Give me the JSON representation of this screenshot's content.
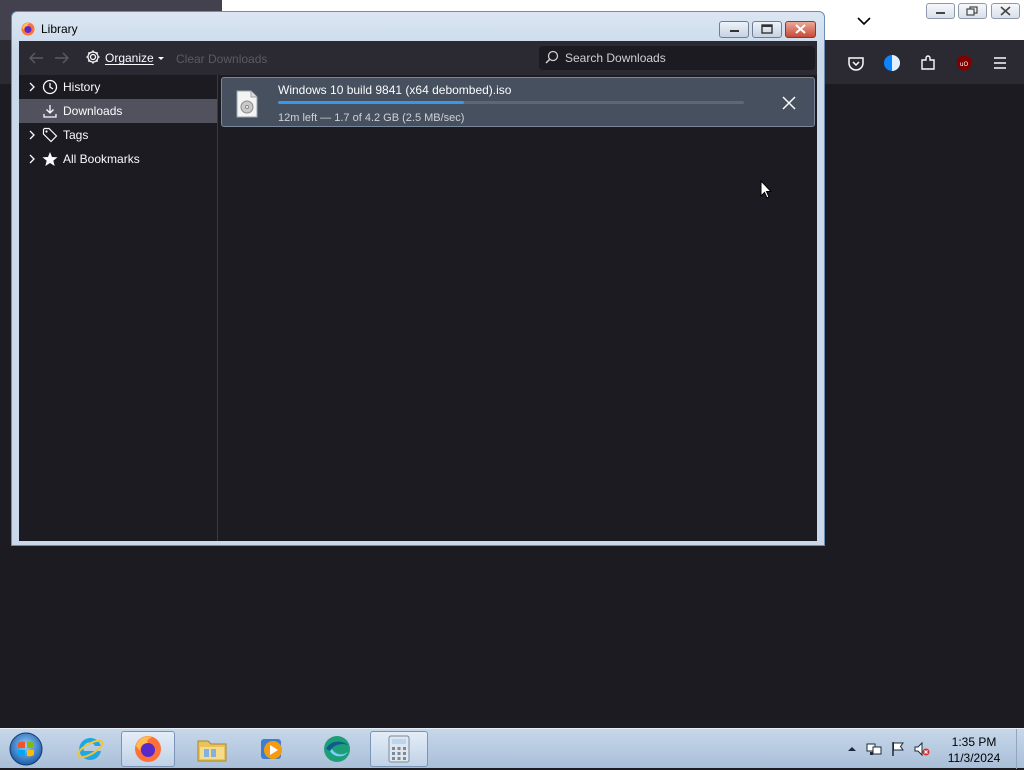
{
  "window": {
    "title": "Library",
    "icon": "firefox-icon"
  },
  "toolbar": {
    "back_icon": "arrow-left-icon",
    "forward_icon": "arrow-right-icon",
    "organize_label": "Organize",
    "clear_downloads_label": "Clear Downloads",
    "search_placeholder": "Search Downloads",
    "search_value": ""
  },
  "sidebar": {
    "items": [
      {
        "label": "History",
        "icon": "clock-icon",
        "expandable": true,
        "selected": false
      },
      {
        "label": "Downloads",
        "icon": "download-icon",
        "expandable": false,
        "selected": true
      },
      {
        "label": "Tags",
        "icon": "tag-icon",
        "expandable": true,
        "selected": false
      },
      {
        "label": "All Bookmarks",
        "icon": "star-icon",
        "expandable": true,
        "selected": false
      }
    ]
  },
  "downloads": [
    {
      "filename": "Windows 10 build 9841 (x64 debombed).iso",
      "status": "12m left — 1.7 of 4.2 GB (2.5 MB/sec)",
      "progress_fraction": 0.4,
      "icon": "disc-image-file-icon"
    }
  ],
  "taskbar": {
    "apps": [
      {
        "name": "internet-explorer",
        "active": false
      },
      {
        "name": "firefox",
        "active": true
      },
      {
        "name": "file-explorer",
        "active": false
      },
      {
        "name": "media-player",
        "active": false
      },
      {
        "name": "green-app",
        "active": false
      },
      {
        "name": "calculator",
        "active": true
      }
    ],
    "clock_time": "1:35 PM",
    "clock_date": "11/3/2024"
  },
  "colors": {
    "accent": "#3b95e8",
    "dark_bg": "#1c1b22",
    "toolbar_bg": "#2b2a33",
    "selected_bg": "#52515e"
  }
}
